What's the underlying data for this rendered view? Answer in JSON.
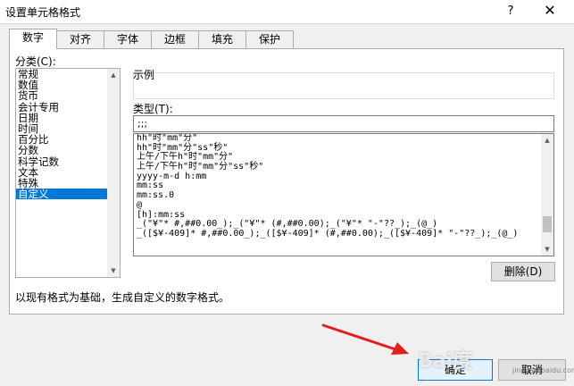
{
  "window": {
    "title": "设置单元格格式",
    "help_label": "?",
    "close_label": "✕"
  },
  "tabs": [
    {
      "label": "数字",
      "active": true
    },
    {
      "label": "对齐",
      "active": false
    },
    {
      "label": "字体",
      "active": false
    },
    {
      "label": "边框",
      "active": false
    },
    {
      "label": "填充",
      "active": false
    },
    {
      "label": "保护",
      "active": false
    }
  ],
  "category": {
    "label": "分类(C):",
    "items": [
      "常规",
      "数值",
      "货币",
      "会计专用",
      "日期",
      "时间",
      "百分比",
      "分数",
      "科学记数",
      "文本",
      "特殊",
      "自定义"
    ],
    "selected_index": 11
  },
  "sample": {
    "label": "示例"
  },
  "type": {
    "label": "类型(T):",
    "value": ";;;"
  },
  "format_list": {
    "items": [
      "hh\"时\"mm\"分\"",
      "hh\"时\"mm\"分\"ss\"秒\"",
      "上午/下午h\"时\"mm\"分\"",
      "上午/下午h\"时\"mm\"分\"ss\"秒\"",
      "yyyy-m-d h:mm",
      "mm:ss",
      "mm:ss.0",
      "@",
      "[h]:mm:ss",
      "_(\"¥\"* #,##0.00_);_(\"¥\"* (#,##0.00);_(\"¥\"* \"-\"??_);_(@_)",
      "_([$¥-409]* #,##0.00_);_([$¥-409]* (#,##0.00);_([$¥-409]* \"-\"??_);_(@_)"
    ]
  },
  "buttons": {
    "delete": "删除(D)",
    "ok": "确定",
    "cancel": "取消"
  },
  "description": "以现有格式为基础，生成自定义的数字格式。",
  "watermark": {
    "text": "Bai度",
    "sub": "jingyan.baidu.com"
  }
}
